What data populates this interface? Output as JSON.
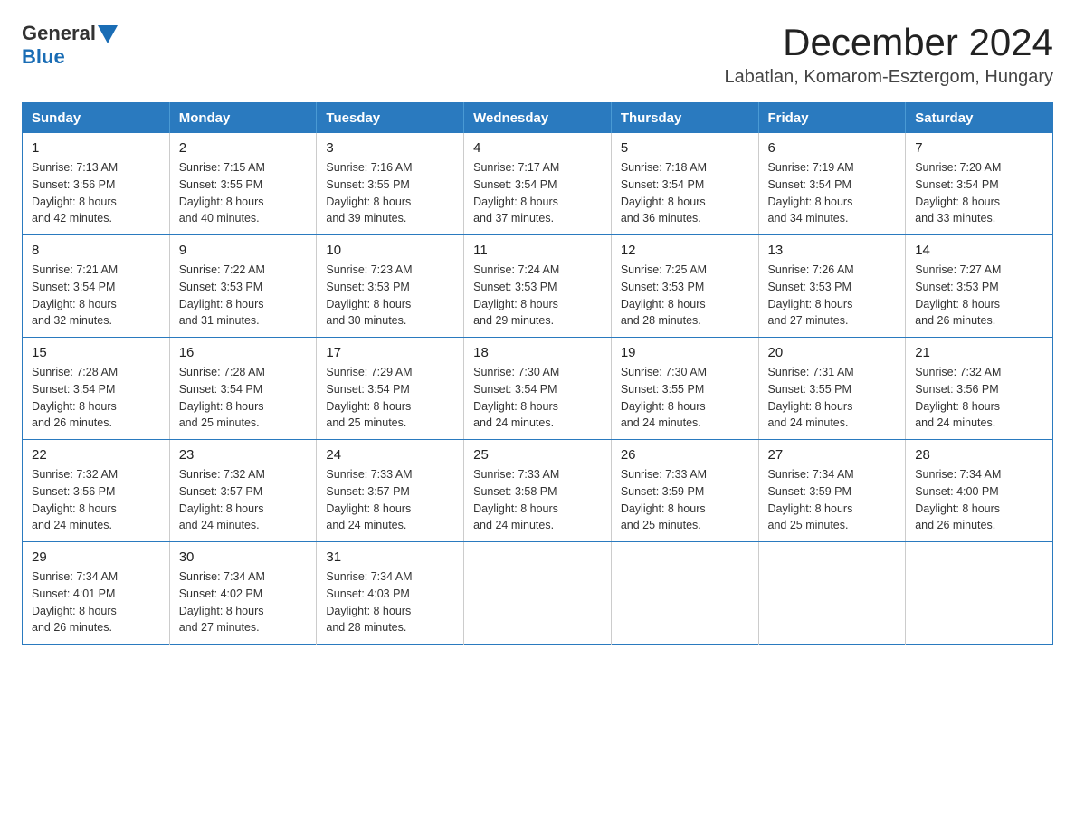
{
  "logo": {
    "text_general": "General",
    "text_blue": "Blue"
  },
  "title": "December 2024",
  "subtitle": "Labatlan, Komarom-Esztergom, Hungary",
  "weekdays": [
    "Sunday",
    "Monday",
    "Tuesday",
    "Wednesday",
    "Thursday",
    "Friday",
    "Saturday"
  ],
  "weeks": [
    [
      {
        "day": "1",
        "sunrise": "7:13 AM",
        "sunset": "3:56 PM",
        "daylight": "8 hours and 42 minutes."
      },
      {
        "day": "2",
        "sunrise": "7:15 AM",
        "sunset": "3:55 PM",
        "daylight": "8 hours and 40 minutes."
      },
      {
        "day": "3",
        "sunrise": "7:16 AM",
        "sunset": "3:55 PM",
        "daylight": "8 hours and 39 minutes."
      },
      {
        "day": "4",
        "sunrise": "7:17 AM",
        "sunset": "3:54 PM",
        "daylight": "8 hours and 37 minutes."
      },
      {
        "day": "5",
        "sunrise": "7:18 AM",
        "sunset": "3:54 PM",
        "daylight": "8 hours and 36 minutes."
      },
      {
        "day": "6",
        "sunrise": "7:19 AM",
        "sunset": "3:54 PM",
        "daylight": "8 hours and 34 minutes."
      },
      {
        "day": "7",
        "sunrise": "7:20 AM",
        "sunset": "3:54 PM",
        "daylight": "8 hours and 33 minutes."
      }
    ],
    [
      {
        "day": "8",
        "sunrise": "7:21 AM",
        "sunset": "3:54 PM",
        "daylight": "8 hours and 32 minutes."
      },
      {
        "day": "9",
        "sunrise": "7:22 AM",
        "sunset": "3:53 PM",
        "daylight": "8 hours and 31 minutes."
      },
      {
        "day": "10",
        "sunrise": "7:23 AM",
        "sunset": "3:53 PM",
        "daylight": "8 hours and 30 minutes."
      },
      {
        "day": "11",
        "sunrise": "7:24 AM",
        "sunset": "3:53 PM",
        "daylight": "8 hours and 29 minutes."
      },
      {
        "day": "12",
        "sunrise": "7:25 AM",
        "sunset": "3:53 PM",
        "daylight": "8 hours and 28 minutes."
      },
      {
        "day": "13",
        "sunrise": "7:26 AM",
        "sunset": "3:53 PM",
        "daylight": "8 hours and 27 minutes."
      },
      {
        "day": "14",
        "sunrise": "7:27 AM",
        "sunset": "3:53 PM",
        "daylight": "8 hours and 26 minutes."
      }
    ],
    [
      {
        "day": "15",
        "sunrise": "7:28 AM",
        "sunset": "3:54 PM",
        "daylight": "8 hours and 26 minutes."
      },
      {
        "day": "16",
        "sunrise": "7:28 AM",
        "sunset": "3:54 PM",
        "daylight": "8 hours and 25 minutes."
      },
      {
        "day": "17",
        "sunrise": "7:29 AM",
        "sunset": "3:54 PM",
        "daylight": "8 hours and 25 minutes."
      },
      {
        "day": "18",
        "sunrise": "7:30 AM",
        "sunset": "3:54 PM",
        "daylight": "8 hours and 24 minutes."
      },
      {
        "day": "19",
        "sunrise": "7:30 AM",
        "sunset": "3:55 PM",
        "daylight": "8 hours and 24 minutes."
      },
      {
        "day": "20",
        "sunrise": "7:31 AM",
        "sunset": "3:55 PM",
        "daylight": "8 hours and 24 minutes."
      },
      {
        "day": "21",
        "sunrise": "7:32 AM",
        "sunset": "3:56 PM",
        "daylight": "8 hours and 24 minutes."
      }
    ],
    [
      {
        "day": "22",
        "sunrise": "7:32 AM",
        "sunset": "3:56 PM",
        "daylight": "8 hours and 24 minutes."
      },
      {
        "day": "23",
        "sunrise": "7:32 AM",
        "sunset": "3:57 PM",
        "daylight": "8 hours and 24 minutes."
      },
      {
        "day": "24",
        "sunrise": "7:33 AM",
        "sunset": "3:57 PM",
        "daylight": "8 hours and 24 minutes."
      },
      {
        "day": "25",
        "sunrise": "7:33 AM",
        "sunset": "3:58 PM",
        "daylight": "8 hours and 24 minutes."
      },
      {
        "day": "26",
        "sunrise": "7:33 AM",
        "sunset": "3:59 PM",
        "daylight": "8 hours and 25 minutes."
      },
      {
        "day": "27",
        "sunrise": "7:34 AM",
        "sunset": "3:59 PM",
        "daylight": "8 hours and 25 minutes."
      },
      {
        "day": "28",
        "sunrise": "7:34 AM",
        "sunset": "4:00 PM",
        "daylight": "8 hours and 26 minutes."
      }
    ],
    [
      {
        "day": "29",
        "sunrise": "7:34 AM",
        "sunset": "4:01 PM",
        "daylight": "8 hours and 26 minutes."
      },
      {
        "day": "30",
        "sunrise": "7:34 AM",
        "sunset": "4:02 PM",
        "daylight": "8 hours and 27 minutes."
      },
      {
        "day": "31",
        "sunrise": "7:34 AM",
        "sunset": "4:03 PM",
        "daylight": "8 hours and 28 minutes."
      },
      null,
      null,
      null,
      null
    ]
  ],
  "labels": {
    "sunrise": "Sunrise:",
    "sunset": "Sunset:",
    "daylight": "Daylight:"
  }
}
